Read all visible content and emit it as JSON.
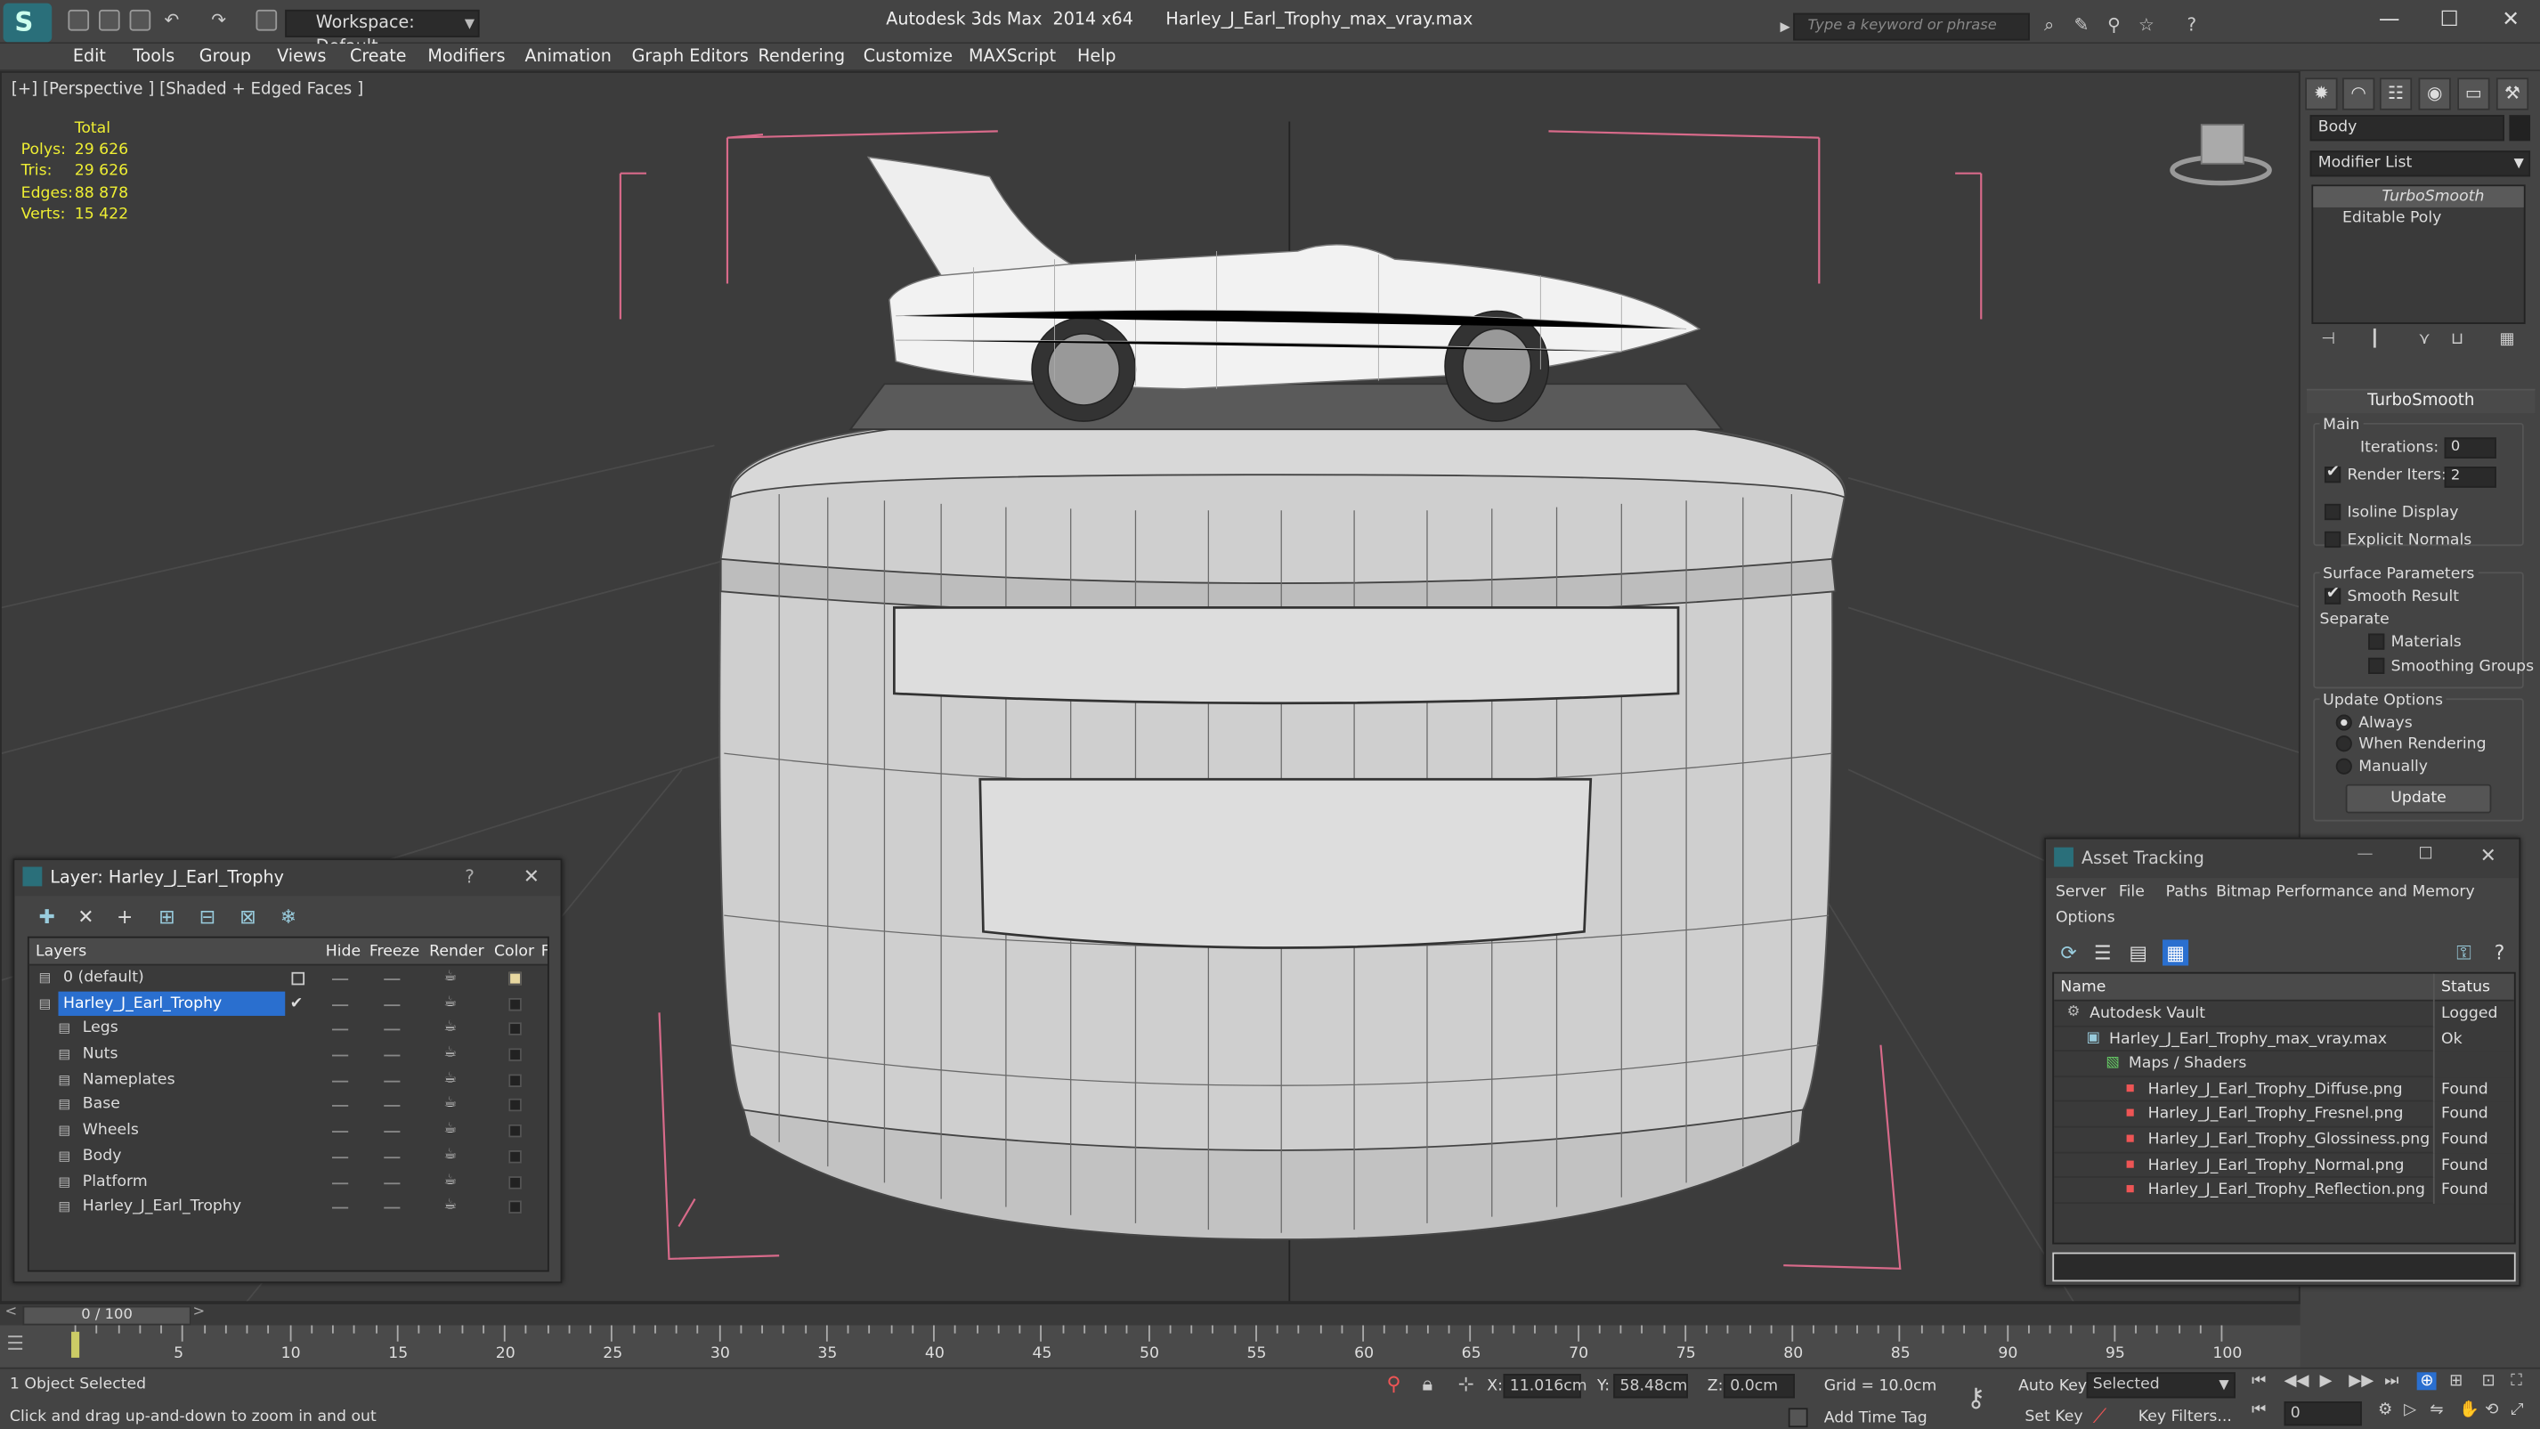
{
  "titlebar": {
    "app": "Autodesk 3ds Max  2014 x64",
    "file": "Harley_J_Earl_Trophy_max_vray.max",
    "workspace": "Workspace: Default",
    "search_placeholder": "Type a keyword or phrase"
  },
  "menus": [
    "Edit",
    "Tools",
    "Group",
    "Views",
    "Create",
    "Modifiers",
    "Animation",
    "Graph Editors",
    "Rendering",
    "Customize",
    "MAXScript",
    "Help"
  ],
  "viewport": {
    "label": "[+] [Perspective ] [Shaded + Edged Faces ]",
    "stats": {
      "total_label": "Total",
      "rows": [
        {
          "label": "Polys:",
          "value": "29 626"
        },
        {
          "label": "Tris:",
          "value": "29 626"
        },
        {
          "label": "Edges:",
          "value": "88 878"
        },
        {
          "label": "Verts:",
          "value": "15 422"
        }
      ]
    }
  },
  "command_panel": {
    "object_name": "Body",
    "modifier_list": "Modifier List",
    "stack": [
      "TurboSmooth",
      "Editable Poly"
    ],
    "turbosmooth": {
      "title": "TurboSmooth",
      "main": "Main",
      "iterations_label": "Iterations:",
      "iterations": "0",
      "render_iters_label": "Render Iters:",
      "render_iters": "2",
      "isoline": "Isoline Display",
      "explicit_normals": "Explicit Normals",
      "surface_params": "Surface Parameters",
      "smooth_result": "Smooth Result",
      "separate": "Separate",
      "materials": "Materials",
      "smoothing_groups": "Smoothing Groups",
      "update_options": "Update Options",
      "always": "Always",
      "when_rendering": "When Rendering",
      "manually": "Manually",
      "update": "Update"
    }
  },
  "layer_dialog": {
    "title": "Layer: Harley_J_Earl_Trophy",
    "columns": [
      "Layers",
      "Hide",
      "Freeze",
      "Render",
      "Color",
      "F"
    ],
    "rows": [
      {
        "name": "0 (default)",
        "indent": 1,
        "selected": false
      },
      {
        "name": "Harley_J_Earl_Trophy",
        "indent": 1,
        "selected": true
      },
      {
        "name": "Legs",
        "indent": 2,
        "selected": false
      },
      {
        "name": "Nuts",
        "indent": 2,
        "selected": false
      },
      {
        "name": "Nameplates",
        "indent": 2,
        "selected": false
      },
      {
        "name": "Base",
        "indent": 2,
        "selected": false
      },
      {
        "name": "Wheels",
        "indent": 2,
        "selected": false
      },
      {
        "name": "Body",
        "indent": 2,
        "selected": false
      },
      {
        "name": "Platform",
        "indent": 2,
        "selected": false
      },
      {
        "name": "Harley_J_Earl_Trophy",
        "indent": 2,
        "selected": false
      }
    ]
  },
  "asset_tracking": {
    "title": "Asset Tracking",
    "menus": [
      "Server",
      "File",
      "Paths",
      "Bitmap Performance and Memory",
      "Options"
    ],
    "columns": [
      "Name",
      "Status"
    ],
    "rows": [
      {
        "name": "Autodesk Vault",
        "status": "Logged Ou",
        "indent": 1
      },
      {
        "name": "Harley_J_Earl_Trophy_max_vray.max",
        "status": "Ok",
        "indent": 2
      },
      {
        "name": "Maps / Shaders",
        "status": "",
        "indent": 3
      },
      {
        "name": "Harley_J_Earl_Trophy_Diffuse.png",
        "status": "Found",
        "indent": 4
      },
      {
        "name": "Harley_J_Earl_Trophy_Fresnel.png",
        "status": "Found",
        "indent": 4
      },
      {
        "name": "Harley_J_Earl_Trophy_Glossiness.png",
        "status": "Found",
        "indent": 4
      },
      {
        "name": "Harley_J_Earl_Trophy_Normal.png",
        "status": "Found",
        "indent": 4
      },
      {
        "name": "Harley_J_Earl_Trophy_Reflection.png",
        "status": "Found",
        "indent": 4
      }
    ]
  },
  "timeline": {
    "frame": "0 / 100",
    "ticks": [
      "0",
      "5",
      "10",
      "15",
      "20",
      "25",
      "30",
      "35",
      "40",
      "45",
      "50",
      "55",
      "60",
      "65",
      "70",
      "75",
      "80",
      "85",
      "90",
      "95",
      "100"
    ]
  },
  "statusbar": {
    "selected": "1 Object Selected",
    "prompt": "Click and drag up-and-down to zoom in and out",
    "x_label": "X:",
    "x": "11.016cm",
    "y_label": "Y:",
    "y": "58.48cm",
    "z_label": "Z:",
    "z": "0.0cm",
    "grid": "Grid = 10.0cm",
    "add_time_tag": "Add Time Tag",
    "auto_key": "Auto Key",
    "set_key": "Set Key",
    "selected_dd": "Selected",
    "key_filters": "Key Filters...",
    "frame_field": "0"
  }
}
